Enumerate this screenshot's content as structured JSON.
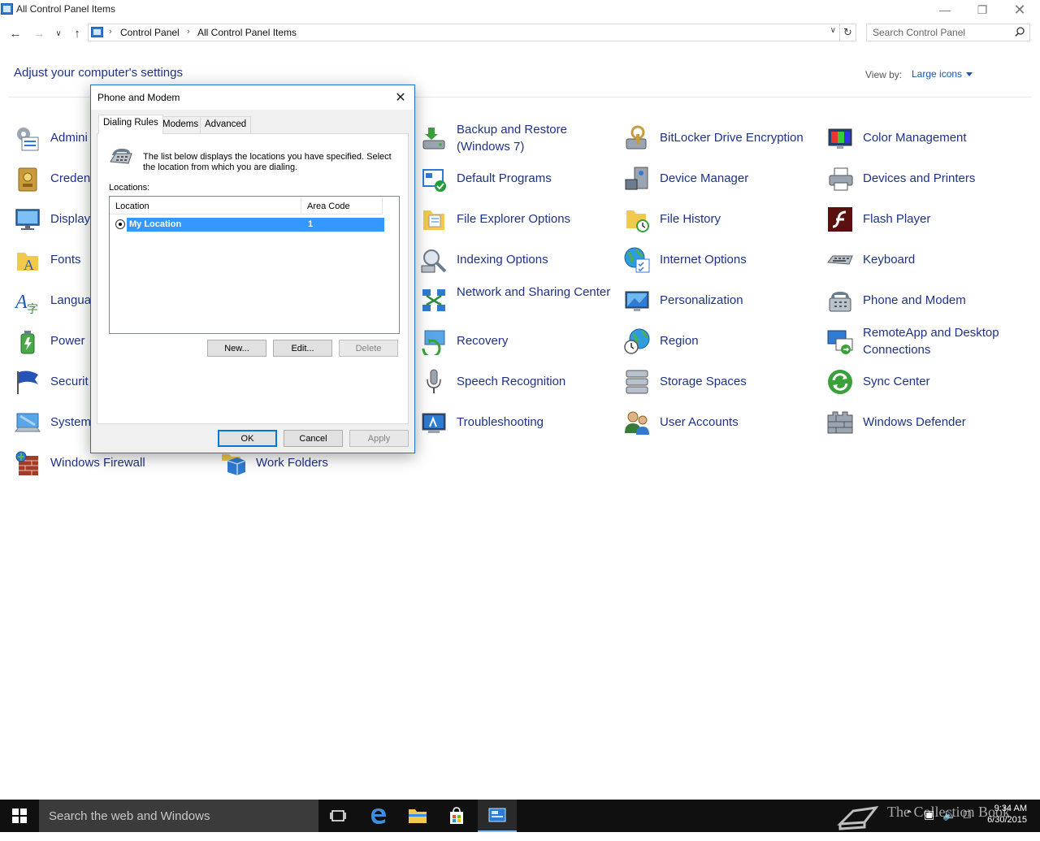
{
  "window": {
    "title": "All Control Panel Items"
  },
  "breadcrumb": [
    "Control Panel",
    "All Control Panel Items"
  ],
  "search": {
    "placeholder": "Search Control Panel"
  },
  "header": {
    "title": "Adjust your computer's settings",
    "view_by_label": "View by:",
    "view_by_value": "Large icons"
  },
  "items": {
    "col1": [
      "Admini",
      "Creden",
      "Display",
      "Fonts",
      "Langua",
      "Power",
      "Securit",
      "System",
      "Windows Firewall"
    ],
    "col2": [
      "Work Folders"
    ],
    "col3": [
      "Backup and Restore (Windows 7)",
      "Default Programs",
      "File Explorer Options",
      "Indexing Options",
      "Network and Sharing Center",
      "Recovery",
      "Speech Recognition",
      "Troubleshooting"
    ],
    "col4": [
      "BitLocker Drive Encryption",
      "Device Manager",
      "File History",
      "Internet Options",
      "Personalization",
      "Region",
      "Storage Spaces",
      "User Accounts"
    ],
    "col5": [
      "Color Management",
      "Devices and Printers",
      "Flash Player",
      "Keyboard",
      "Phone and Modem",
      "RemoteApp and Desktop Connections",
      "Sync Center",
      "Windows Defender"
    ]
  },
  "dialog": {
    "title": "Phone and Modem",
    "tabs": [
      "Dialing Rules",
      "Modems",
      "Advanced"
    ],
    "intro": "The list below displays the locations you have specified. Select the location from which you are dialing.",
    "locations_label": "Locations:",
    "columns": [
      "Location",
      "Area Code"
    ],
    "rows": [
      {
        "location": "My Location",
        "area_code": "1"
      }
    ],
    "buttons": {
      "new": "New...",
      "edit": "Edit...",
      "delete": "Delete",
      "ok": "OK",
      "cancel": "Cancel",
      "apply": "Apply"
    }
  },
  "taskbar": {
    "search_text": "Search the web and Windows",
    "watermark": "The Collection Book",
    "time": "9:34 AM",
    "date": "6/30/2015"
  },
  "colors": {
    "link": "#1e3287",
    "accent": "#0078d7",
    "selection": "#3399ff"
  }
}
